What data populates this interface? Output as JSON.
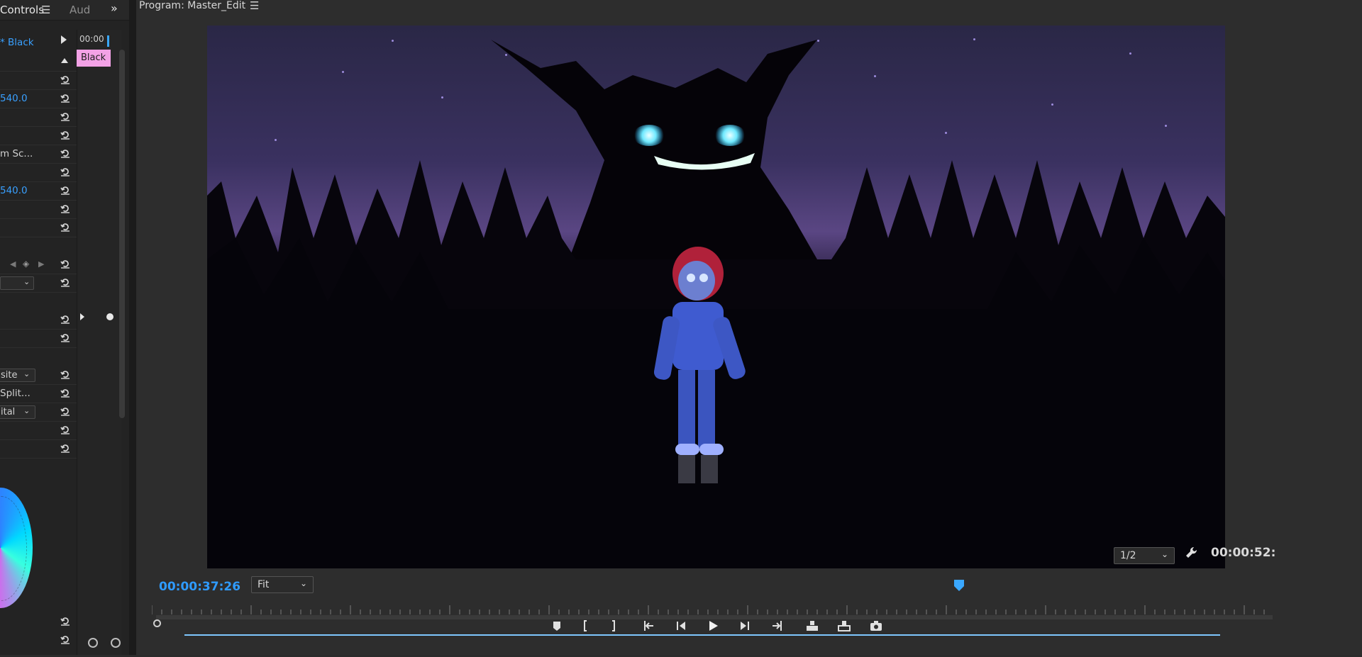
{
  "left_panel": {
    "tabs": [
      {
        "label": "Controls",
        "active": true
      },
      {
        "label": "Aud",
        "active": false
      }
    ],
    "clip_name": "* Black",
    "mini_timeline_time": "00:00",
    "clip_label": "Black",
    "rows": [
      {
        "label": "",
        "value": ""
      },
      {
        "label": "540.0",
        "value": "540.0"
      },
      {
        "label": "",
        "value": ""
      },
      {
        "label": "m Sc...",
        "value": ""
      },
      {
        "label": "",
        "value": ""
      },
      {
        "label": "540.0",
        "value": "540.0"
      },
      {
        "label": "",
        "value": ""
      },
      {
        "label": "",
        "value": ""
      }
    ],
    "dropdowns": [
      {
        "label": "site"
      },
      {
        "label": "Split..."
      },
      {
        "label": "ital"
      }
    ]
  },
  "monitor": {
    "title": "Program: Master_Edit",
    "timecode_current": "00:00:37:26",
    "timecode_duration": "00:00:52:",
    "zoom_select": "Fit",
    "resolution_select": "1/2",
    "playhead_position": 0.72
  },
  "icons": {
    "reset": "reset-icon",
    "menu": "hamburger-menu-icon",
    "expand": "double-chevron-right-icon",
    "wrench": "wrench-icon"
  },
  "colors": {
    "accent_blue": "#2f9bff",
    "clip_label_pink": "#f3a2e6",
    "panel_bg": "#232323"
  }
}
